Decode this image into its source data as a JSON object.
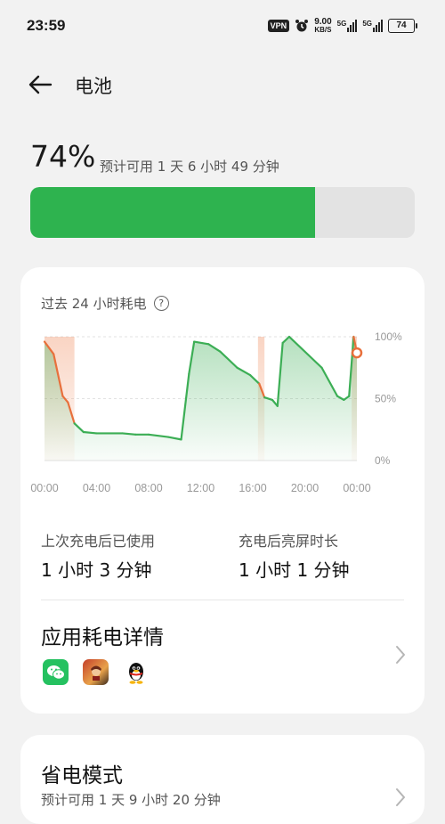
{
  "status": {
    "time": "23:59",
    "vpn": "VPN",
    "speed_value": "9.00",
    "speed_unit": "KB/S",
    "sim1": "5G",
    "sim2": "5G",
    "battery_level": "74"
  },
  "header": {
    "title": "电池"
  },
  "battery": {
    "percent_text": "74%",
    "level": 74,
    "estimate": "预计可用 1 天 6 小时 49 分钟",
    "fill_color": "#2eb34f"
  },
  "usage_chart": {
    "title": "过去 24 小时耗电"
  },
  "chart_data": {
    "type": "area",
    "title": "",
    "xlabel": "",
    "ylabel": "",
    "x_ticks": [
      "00:00",
      "04:00",
      "08:00",
      "12:00",
      "16:00",
      "20:00",
      "00:00"
    ],
    "y_ticks": [
      "100%",
      "50%",
      "0%"
    ],
    "ylim": [
      0,
      100
    ],
    "xlim": [
      0,
      24
    ],
    "grid": true,
    "line_color_discharging": "#3cae55",
    "line_color_charging": "#e8703c",
    "series": [
      {
        "values": [
          [
            0,
            96
          ],
          [
            0.7,
            86
          ],
          [
            1.4,
            52
          ],
          [
            1.8,
            47
          ],
          [
            2.3,
            30
          ],
          [
            3,
            23
          ],
          [
            4,
            22
          ],
          [
            6,
            22
          ],
          [
            7,
            21
          ],
          [
            8,
            21
          ],
          [
            9.5,
            19
          ],
          [
            10.5,
            17
          ],
          [
            11.1,
            70
          ],
          [
            11.5,
            96
          ],
          [
            12.6,
            94
          ],
          [
            13.5,
            88
          ],
          [
            14.8,
            75
          ],
          [
            15.8,
            69
          ],
          [
            16.5,
            62
          ],
          [
            16.9,
            51
          ],
          [
            17.5,
            49
          ],
          [
            17.9,
            44
          ],
          [
            18.3,
            95
          ],
          [
            18.8,
            100
          ],
          [
            21.3,
            75
          ],
          [
            22.5,
            52
          ],
          [
            23,
            49
          ],
          [
            23.4,
            52
          ],
          [
            23.75,
            100
          ],
          [
            24,
            87
          ]
        ],
        "charging_segments": [
          [
            0,
            2.3
          ],
          [
            16.4,
            16.9
          ],
          [
            23.6,
            24
          ]
        ]
      }
    ]
  },
  "stats": {
    "since_charge_label": "上次充电后已使用",
    "since_charge_value": "1 小时 3 分钟",
    "screen_on_label": "充电后亮屏时长",
    "screen_on_value": "1 小时 1 分钟"
  },
  "app_details": {
    "title": "应用耗电详情",
    "apps": [
      {
        "name": "wechat",
        "icon": "wechat-icon"
      },
      {
        "name": "honor-of-kings",
        "icon": "game-icon"
      },
      {
        "name": "qq",
        "icon": "qq-penguin-icon"
      }
    ]
  },
  "power_saving": {
    "title": "省电模式",
    "subtitle": "预计可用 1 天 9 小时 20 分钟"
  }
}
